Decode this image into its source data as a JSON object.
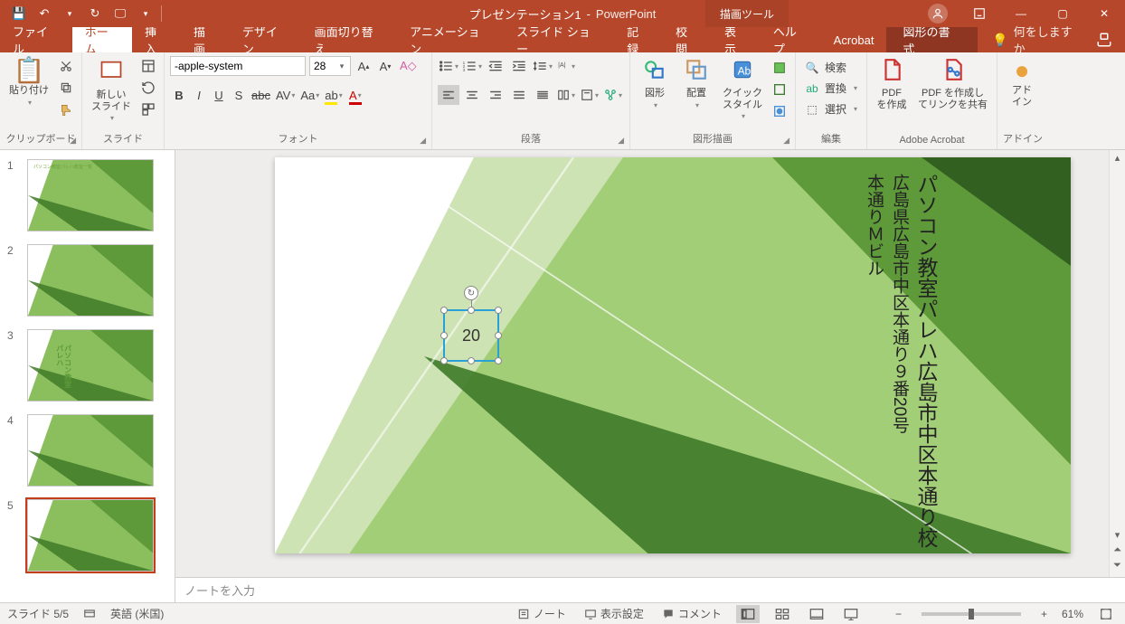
{
  "title": {
    "document": "プレゼンテーション1",
    "app": "PowerPoint",
    "context_tool": "描画ツール"
  },
  "qat": {
    "save": "💾",
    "undo": "↶",
    "redo": "↻",
    "start": "🖵",
    "dd": "▾"
  },
  "window": {
    "min": "—",
    "max": "▢",
    "close": "✕",
    "ribbon": "⬍"
  },
  "tabs": {
    "file": "ファイル",
    "home": "ホーム",
    "insert": "挿入",
    "draw": "描画",
    "design": "デザイン",
    "transitions": "画面切り替え",
    "animations": "アニメーション",
    "slideshow": "スライド ショー",
    "record": "記録",
    "review": "校閲",
    "view": "表示",
    "help": "ヘルプ",
    "acrobat": "Acrobat",
    "format": "図形の書式",
    "tellme": "何をしますか"
  },
  "ribbon": {
    "clipboard": {
      "paste": "貼り付け",
      "label": "クリップボード"
    },
    "slides": {
      "new": "新しい\nスライド",
      "label": "スライド"
    },
    "font": {
      "name": "-apple-system",
      "size": "28",
      "label": "フォント"
    },
    "paragraph": {
      "label": "段落"
    },
    "drawing": {
      "shapes": "図形",
      "arrange": "配置",
      "quick": "クイック\nスタイル",
      "label": "図形描画"
    },
    "editing": {
      "find": "検索",
      "replace": "置換",
      "select": "選択",
      "label": "編集"
    },
    "acrobat": {
      "create": "PDF\nを作成",
      "share": "PDF を作成し\nてリンクを共有",
      "label": "Adobe Acrobat"
    },
    "addin": {
      "addin": "アド\nイン",
      "label": "アドイン"
    }
  },
  "slide": {
    "text1": "パソコン教室パレハ広島市中区本通り校",
    "text2": "広島県広島市中区本通り９番20号",
    "text3": "本通りＭビル",
    "selected_text": "20"
  },
  "thumbnails": [
    "1",
    "2",
    "3",
    "4",
    "5"
  ],
  "notes_placeholder": "ノートを入力",
  "status": {
    "slide": "スライド 5/5",
    "lang": "英語 (米国)",
    "notes": "ノート",
    "display": "表示設定",
    "comments": "コメント",
    "zoom": "61%"
  }
}
